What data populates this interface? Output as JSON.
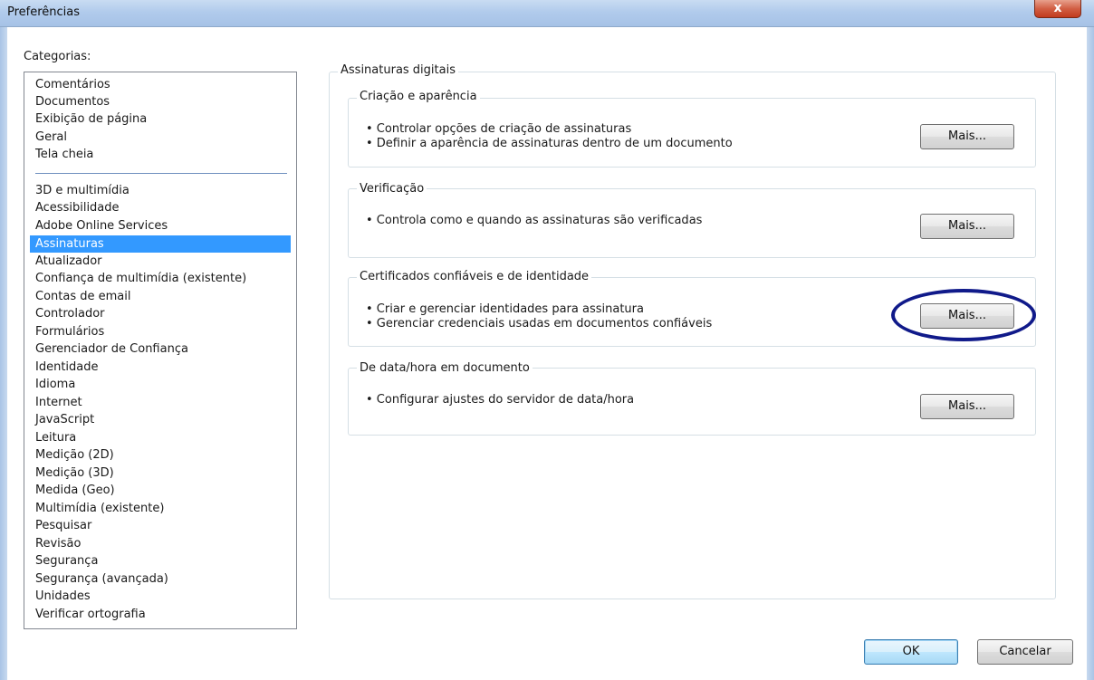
{
  "window": {
    "title": "Preferências",
    "close_label": "x"
  },
  "categories": {
    "label": "Categorias:",
    "group_top": [
      "Comentários",
      "Documentos",
      "Exibição de página",
      "Geral",
      "Tela cheia"
    ],
    "group_bottom": [
      "3D e multimídia",
      "Acessibilidade",
      "Adobe Online Services",
      "Assinaturas",
      "Atualizador",
      "Confiança de multimídia (existente)",
      "Contas de email",
      "Controlador",
      "Formulários",
      "Gerenciador de Confiança",
      "Identidade",
      "Idioma",
      "Internet",
      "JavaScript",
      "Leitura",
      "Medição (2D)",
      "Medição (3D)",
      "Medida (Geo)",
      "Multimídia (existente)",
      "Pesquisar",
      "Revisão",
      "Segurança",
      "Segurança (avançada)",
      "Unidades",
      "Verificar ortografia"
    ],
    "selected": "Assinaturas"
  },
  "panel": {
    "title": "Assinaturas digitais",
    "sections": [
      {
        "title": "Criação e aparência",
        "bullets": [
          "• Controlar opções de criação de assinaturas",
          "• Definir a aparência de assinaturas dentro de um documento"
        ],
        "button": "Mais..."
      },
      {
        "title": "Verificação",
        "bullets": [
          "• Controla como e quando as assinaturas são verificadas"
        ],
        "button": "Mais..."
      },
      {
        "title": "Certificados confiáveis e de identidade",
        "bullets": [
          "• Criar e gerenciar identidades para assinatura",
          "• Gerenciar credenciais usadas em documentos confiáveis"
        ],
        "button": "Mais..."
      },
      {
        "title": "De data/hora em documento",
        "bullets": [
          "• Configurar ajustes do servidor de data/hora"
        ],
        "button": "Mais..."
      }
    ]
  },
  "footer": {
    "ok_label": "OK",
    "cancel_label": "Cancelar"
  },
  "colors": {
    "selection": "#3399ff",
    "highlight_ellipse": "#101a8a"
  }
}
